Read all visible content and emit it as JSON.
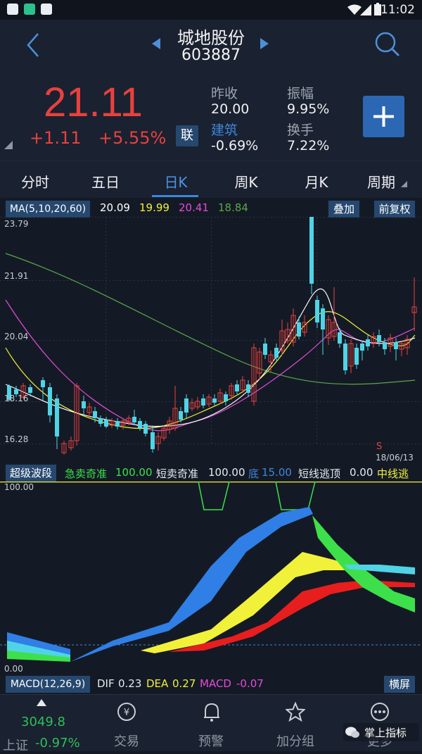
{
  "status_bar": {
    "time": "11:02"
  },
  "header": {
    "stock_name": "城地股份",
    "stock_code": "603887"
  },
  "quote": {
    "price": "21.11",
    "change": "+1.11",
    "change_pct": "+5.55%",
    "badge": "联",
    "prev_close_label": "昨收",
    "prev_close": "20.00",
    "sector_label": "建筑",
    "sector_change": "-0.69%",
    "amplitude_label": "振幅",
    "amplitude": "9.95%",
    "turnover_label": "换手",
    "turnover": "7.22%"
  },
  "tabs": [
    "分时",
    "五日",
    "日K",
    "周K",
    "月K",
    "周期"
  ],
  "active_tab": 2,
  "ma": {
    "label": "MA(5,10,20,60)",
    "ma5": "20.09",
    "ma10": "19.99",
    "ma20": "20.41",
    "ma60": "18.84",
    "overlay_button": "叠加",
    "adjust_button": "前复权"
  },
  "chart_labels": {
    "y_top": "23.79",
    "y_2": "21.91",
    "y_3": "20.04",
    "y_4": "18.16",
    "y_bottom": "16.28",
    "date": "18/06/13",
    "signal": "S"
  },
  "indicator": {
    "name": "超级波段",
    "sell_label": "急卖奇准",
    "sell_value": "100.00",
    "short_label": "短卖奇准",
    "short_value": "100.00",
    "bottom_label": "底",
    "bottom_value": "15.00",
    "escape_label": "短线逃顶",
    "escape_value": "0.00",
    "mid_label": "中线逃",
    "y_top": "100.00",
    "y_bottom": "0.00"
  },
  "macd": {
    "label": "MACD(12,26,9)",
    "dif_label": "DIF",
    "dif": "0.23",
    "dea_label": "DEA",
    "dea": "0.27",
    "macd_label": "MACD",
    "macd": "-0.07",
    "fullscreen_button": "横屏"
  },
  "bottom_nav": {
    "index_value": "3049.8",
    "index_name": "上证",
    "index_change": "-0.97%",
    "trade": "交易",
    "alert": "预警",
    "add_group": "加分组",
    "more": "更多",
    "watermark": "掌上指标"
  },
  "colors": {
    "up": "#e8413e",
    "down": "#4fd4e6",
    "accent": "#2c67b3",
    "ma5": "#ffffff",
    "ma10": "#f1f13a",
    "ma20": "#e44bd9",
    "ma60": "#5aa64a"
  }
}
